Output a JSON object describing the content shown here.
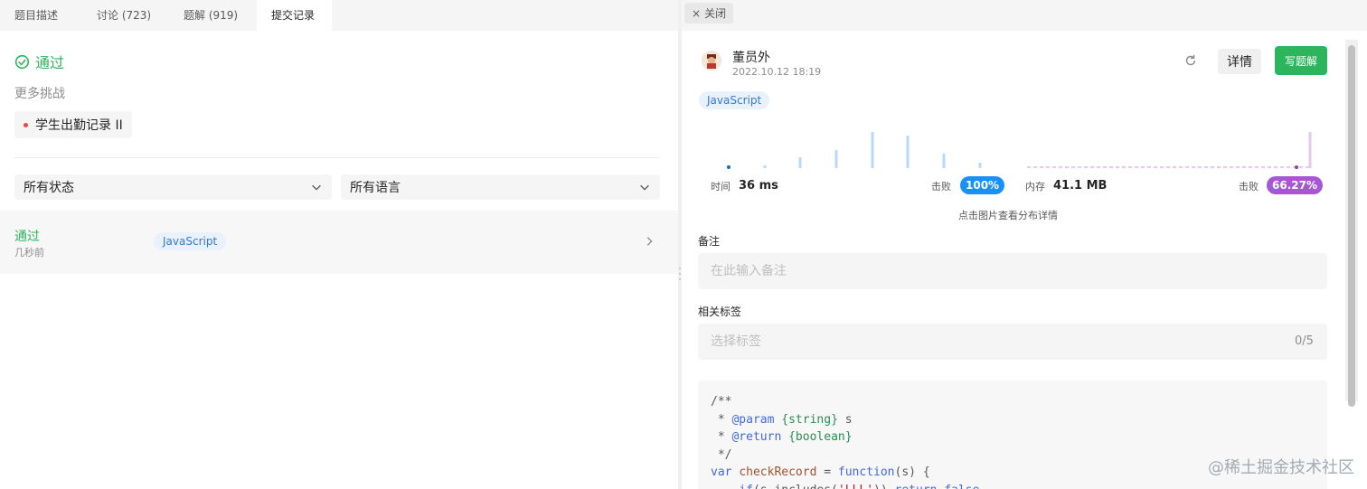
{
  "left": {
    "tabs": [
      {
        "label": "题目描述"
      },
      {
        "label": "讨论 (723)"
      },
      {
        "label": "题解 (919)"
      },
      {
        "label": "提交记录"
      }
    ],
    "result_title": "通过",
    "more_challenges": "更多挑战",
    "challenge_item": "学生出勤记录 II",
    "filters": {
      "status": "所有状态",
      "language": "所有语言"
    },
    "submission": {
      "status": "通过",
      "time": "几秒前",
      "language": "JavaScript"
    }
  },
  "right": {
    "close_label": "关闭",
    "user": {
      "name": "董员外",
      "date": "2022.10.12 18:19"
    },
    "detail_label": "详情",
    "write_label": "写题解",
    "language_tag": "JavaScript",
    "stats": {
      "time_label": "时间",
      "time_value": "36 ms",
      "beat_label_1": "击败",
      "time_beat": "100%",
      "memory_label": "内存",
      "memory_value": "41.1 MB",
      "beat_label_2": "击败",
      "memory_beat": "66.27%"
    },
    "chart_hint": "点击图片查看分布详情",
    "notes_label": "备注",
    "notes_placeholder": "在此输入备注",
    "tags_label": "相关标签",
    "tags_placeholder": "选择标签",
    "tags_count": "0/5",
    "code_lines": [
      "/**",
      " * @param {string} s",
      " * @return {boolean}",
      " */",
      "var checkRecord = function(s) {",
      "    if(s.includes('LLL')) return false"
    ]
  },
  "watermark": "@稀土掘金技术社区",
  "colors": {
    "accent_green": "#2db55d",
    "time_badge": "#1a90ff",
    "memory_badge": "#a855d6"
  }
}
